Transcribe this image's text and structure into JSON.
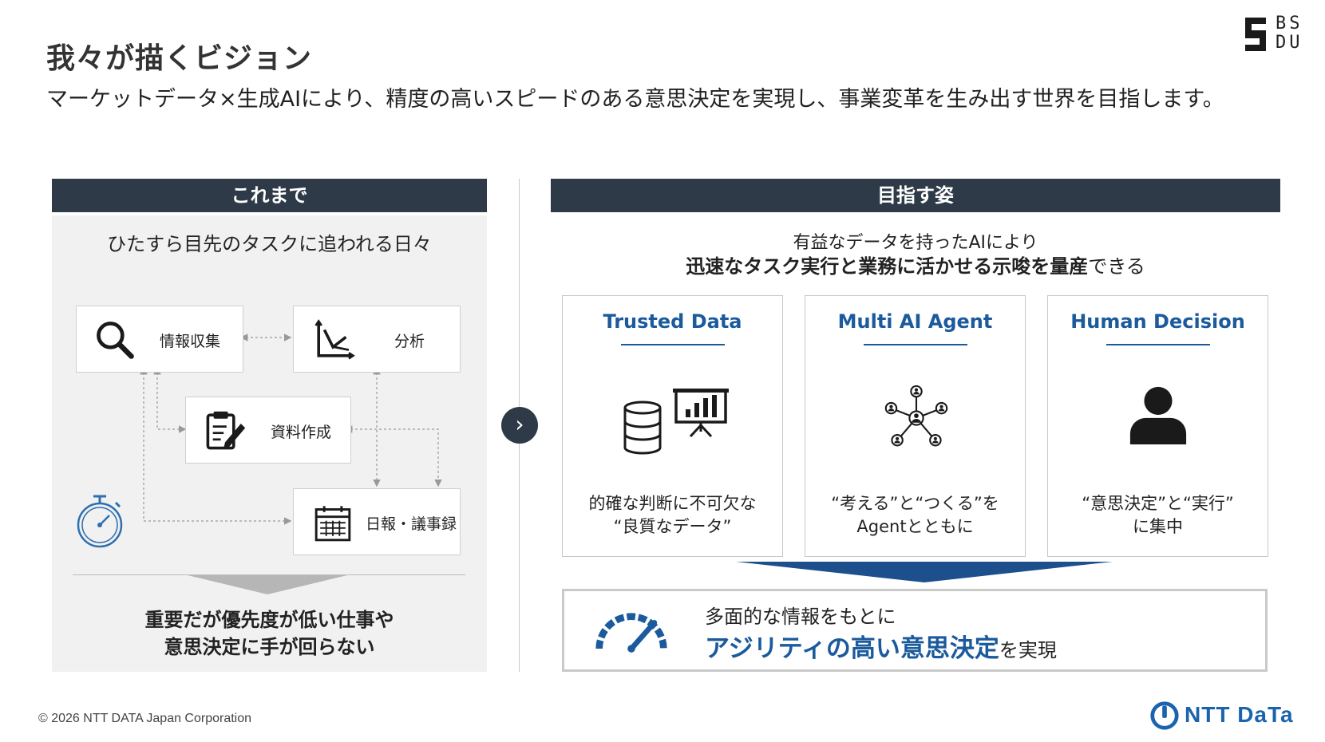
{
  "header": {
    "title": "我々が描くビジョン",
    "subtitle": "マーケットデータ×生成AIにより、精度の高いスピードのある意思決定を実現し、事業変革を生み出す世界を目指します。"
  },
  "logo": {
    "line1": "BS",
    "line2": "DU"
  },
  "left_panel": {
    "header": "これまで",
    "subtitle": "ひたすら目先のタスクに追われる日々",
    "tasks": [
      {
        "label": "情報収集",
        "icon": "magnifier-icon"
      },
      {
        "label": "分析",
        "icon": "chart-axis-icon"
      },
      {
        "label": "資料作成",
        "icon": "clipboard-pen-icon"
      },
      {
        "label": "日報・議事録",
        "icon": "calendar-icon"
      }
    ],
    "conclusion_line1": "重要だが優先度が低い仕事や",
    "conclusion_line2": "意思決定に手が回らない"
  },
  "right_panel": {
    "header": "目指す姿",
    "subtitle_line1": "有益なデータを持ったAIにより",
    "subtitle_line2_bold": "迅速なタスク実行と業務に活かせる示唆を量産",
    "subtitle_line2_normal": "できる",
    "cards": [
      {
        "title": "Trusted Data",
        "desc_line1": "的確な判断に不可欠な",
        "desc_line2": "“良質なデータ”",
        "icon": "database-presentation-icon"
      },
      {
        "title": "Multi AI Agent",
        "desc_line1": "“考える”と“つくる”を",
        "desc_line2": "Agentとともに",
        "icon": "network-agents-icon"
      },
      {
        "title": "Human Decision",
        "desc_line1": "“意思決定”と“実行”",
        "desc_line2": "に集中",
        "icon": "person-icon"
      }
    ],
    "result_line1": "多面的な情報をもとに",
    "result_line2_bold": "アジリティの高い意思決定",
    "result_line2_normal": "を実現"
  },
  "footer": {
    "copyright": "© 2026 NTT DATA Japan Corporation",
    "brand": "NTT DaTa"
  },
  "colors": {
    "navy": "#2e3a48",
    "blue": "#1b5a9c",
    "dark_blue": "#1c4f8c"
  }
}
